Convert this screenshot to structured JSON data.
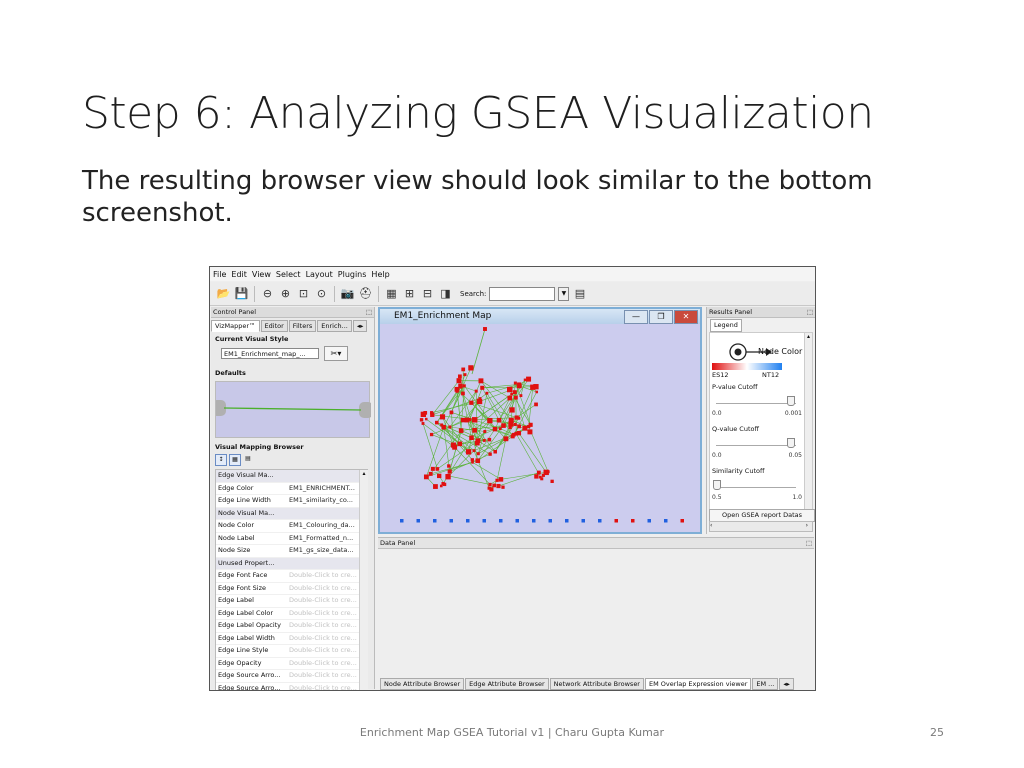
{
  "slide": {
    "title": "Step 6: Analyzing GSEA Visualization",
    "subtitle": "The resulting browser view should look similar to the bottom screenshot.",
    "footer": "Enrichment Map GSEA Tutorial v1 | Charu Gupta Kumar",
    "page_number": "25"
  },
  "app": {
    "menu": [
      "File",
      "Edit",
      "View",
      "Select",
      "Layout",
      "Plugins",
      "Help"
    ],
    "search_label": "Search:",
    "control_panel": {
      "title": "Control Panel",
      "tabs": [
        "VizMapper™",
        "Editor",
        "Filters",
        "Enrich..."
      ],
      "current_visual_style_label": "Current Visual Style",
      "current_visual_style_value": "EM1_Enrichment_map_...",
      "defaults_label": "Defaults",
      "vmb_label": "Visual Mapping Browser",
      "properties": [
        {
          "k": "Edge Visual Ma...",
          "v": "",
          "group": true
        },
        {
          "k": "Edge Color",
          "v": "EM1_ENRICHMENT...",
          "group": false
        },
        {
          "k": "Edge Line Width",
          "v": "EM1_similarity_co...",
          "group": false
        },
        {
          "k": "Node Visual Ma...",
          "v": "",
          "group": true
        },
        {
          "k": "Node Color",
          "v": "EM1_Colouring_da...",
          "group": false
        },
        {
          "k": "Node Label",
          "v": "EM1_Formatted_n...",
          "group": false
        },
        {
          "k": "Node Size",
          "v": "EM1_gs_size_data...",
          "group": false
        },
        {
          "k": "Unused Propert...",
          "v": "",
          "group": true
        },
        {
          "k": "Edge Font Face",
          "v": "Double-Click to cre...",
          "group": false,
          "dim": true
        },
        {
          "k": "Edge Font Size",
          "v": "Double-Click to cre...",
          "group": false,
          "dim": true
        },
        {
          "k": "Edge Label",
          "v": "Double-Click to cre...",
          "group": false,
          "dim": true
        },
        {
          "k": "Edge Label Color",
          "v": "Double-Click to cre...",
          "group": false,
          "dim": true
        },
        {
          "k": "Edge Label Opacity",
          "v": "Double-Click to cre...",
          "group": false,
          "dim": true
        },
        {
          "k": "Edge Label Width",
          "v": "Double-Click to cre...",
          "group": false,
          "dim": true
        },
        {
          "k": "Edge Line Style",
          "v": "Double-Click to cre...",
          "group": false,
          "dim": true
        },
        {
          "k": "Edge Opacity",
          "v": "Double-Click to cre...",
          "group": false,
          "dim": true
        },
        {
          "k": "Edge Source Arro...",
          "v": "Double-Click to cre...",
          "group": false,
          "dim": true
        },
        {
          "k": "Edge Source Arro...",
          "v": "Double-Click to cre...",
          "group": false,
          "dim": true
        }
      ]
    },
    "network_window": {
      "title": "EM1_Enrichment Map"
    },
    "results_panel": {
      "title": "Results Panel",
      "legend_tab": "Legend",
      "node_color_label": "Node Color",
      "es_label": "ES12",
      "nt_label": "NT12",
      "pvalue_label": "P-value Cutoff",
      "pvalue_min": "0.0",
      "pvalue_max": "0.001",
      "qvalue_label": "Q-value Cutoff",
      "qvalue_min": "0.0",
      "qvalue_max": "0.05",
      "similarity_label": "Similarity Cutoff",
      "similarity_min": "0.5",
      "similarity_max": "1.0",
      "open_button": "Open GSEA report Datas"
    },
    "data_panel": {
      "title": "Data Panel",
      "tabs": [
        "Node Attribute Browser",
        "Edge Attribute Browser",
        "Network Attribute Browser",
        "EM Overlap Expression viewer",
        "EM ..."
      ]
    },
    "colors": {
      "node_red": "#e01010",
      "node_blue": "#2060e0",
      "edge_green": "#5bb33a",
      "canvas_bg": "#ccccee"
    }
  }
}
